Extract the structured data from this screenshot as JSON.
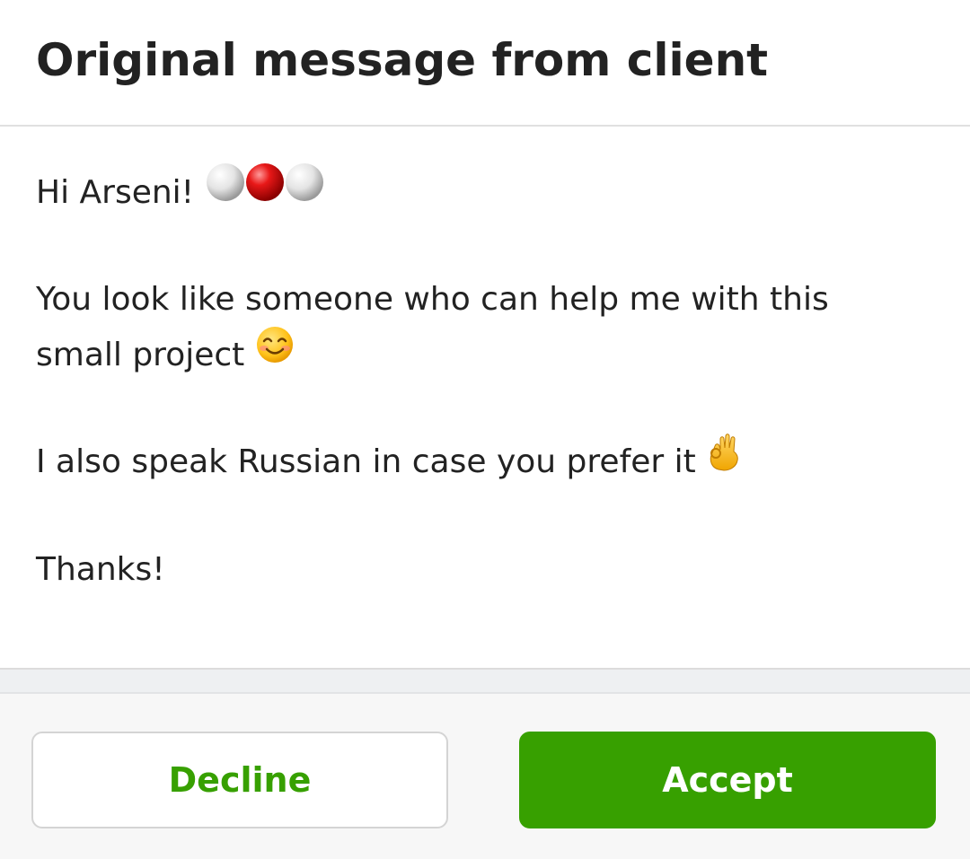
{
  "header": {
    "title": "Original message from client"
  },
  "message": {
    "greeting": "Hi Arseni!",
    "greeting_icon": "three-balls-emoji",
    "line2_part1": "You look like someone who can help me with this",
    "line2_part2": "small project",
    "line2_icon": "smiling-face-emoji",
    "line3": "I also speak Russian in case you prefer it",
    "line3_icon": "ok-hand-emoji",
    "closing": "Thanks!"
  },
  "actions": {
    "decline_label": "Decline",
    "accept_label": "Accept"
  },
  "colors": {
    "accent_green": "#37a000",
    "text": "#222222",
    "divider": "#dcdcdc",
    "footer_bg": "#f7f7f7"
  }
}
